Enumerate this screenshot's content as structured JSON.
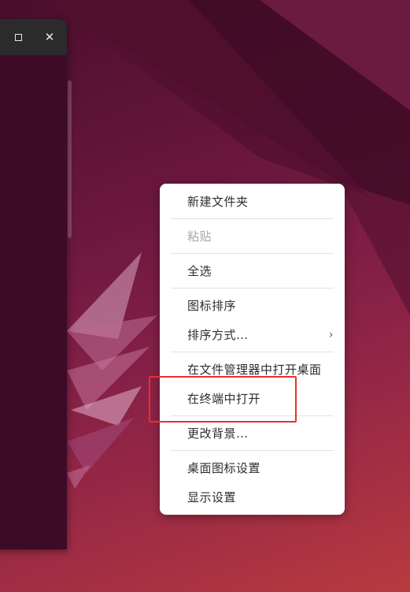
{
  "window": {
    "maximize_icon": "maximize-icon",
    "close_icon": "close-icon",
    "close_glyph": "✕"
  },
  "context_menu": {
    "new_folder": "新建文件夹",
    "paste": "粘贴",
    "select_all": "全选",
    "arrange_icons": "图标排序",
    "sort_by": "排序方式…",
    "sort_by_arrow": "›",
    "open_desktop_in_files": "在文件管理器中打开桌面",
    "open_in_terminal": "在终端中打开",
    "change_background": "更改背景…",
    "desktop_icon_settings": "桌面图标设置",
    "display_settings": "显示设置"
  },
  "colors": {
    "highlight_box": "#e8302b",
    "menu_background": "#ffffff",
    "disabled_text": "#a7a7a7"
  }
}
